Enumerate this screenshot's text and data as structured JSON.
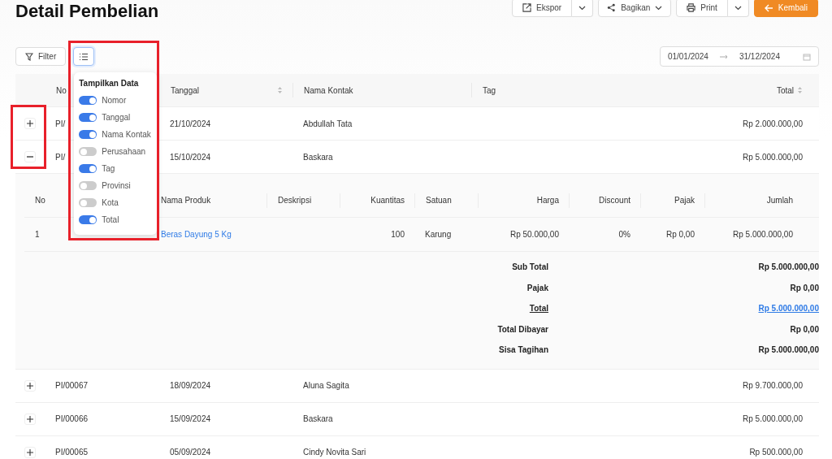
{
  "title": "Detail Pembelian",
  "actions": [
    {
      "label": "Ekspor",
      "kind": "split"
    },
    {
      "label": "Bagikan",
      "kind": "dropdown"
    },
    {
      "label": "Print",
      "kind": "split"
    },
    {
      "label": "Kembali",
      "kind": "primary"
    }
  ],
  "filter_button": {
    "label": "Filter"
  },
  "date_range": {
    "start": "01/01/2024",
    "end": "31/12/2024"
  },
  "column_menu": {
    "title": "Tampilkan Data",
    "items": [
      {
        "label": "Nomor",
        "on": true
      },
      {
        "label": "Tanggal",
        "on": true
      },
      {
        "label": "Nama Kontak",
        "on": true
      },
      {
        "label": "Perusahaan",
        "on": false
      },
      {
        "label": "Tag",
        "on": true
      },
      {
        "label": "Provinsi",
        "on": false
      },
      {
        "label": "Kota",
        "on": false
      },
      {
        "label": "Total",
        "on": true
      }
    ]
  },
  "table": {
    "columns": [
      {
        "label": "No"
      },
      {
        "label": "Tanggal",
        "sortable": true
      },
      {
        "label": "Nama Kontak",
        "sortable": false
      },
      {
        "label": "Tag",
        "sortable": false
      },
      {
        "label": "Total",
        "sortable": true
      }
    ],
    "rows": [
      {
        "expanded": false,
        "nomor": "PI/",
        "tanggal": "21/10/2024",
        "kontak": "Abdullah Tata",
        "total": "Rp 2.000.000,00"
      },
      {
        "expanded": true,
        "nomor": "PI/",
        "tanggal": "15/10/2024",
        "kontak": "Baskara",
        "total": "Rp 5.000.000,00",
        "detail": {
          "columns": [
            "No",
            "Nama Produk",
            "Deskripsi",
            "Kuantitas",
            "Satuan",
            "Harga",
            "Discount",
            "Pajak",
            "Jumlah"
          ],
          "items": [
            {
              "no": "1",
              "produk": "Beras Dayung 5 Kg",
              "kuantitas": "100",
              "satuan": "Karung",
              "harga": "Rp 50.000,00",
              "discount": "0%",
              "pajak": "Rp 0,00",
              "jumlah": "Rp 5.000.000,00"
            }
          ],
          "summary": [
            {
              "label": "Sub Total",
              "value": "Rp 5.000.000,00",
              "kind": "plain"
            },
            {
              "label": "Pajak",
              "value": "Rp 0,00",
              "kind": "plain"
            },
            {
              "label": "Total",
              "value": "Rp 5.000.000,00",
              "kind": "link"
            },
            {
              "label": "Total Dibayar",
              "value": "Rp 0,00",
              "kind": "plain"
            },
            {
              "label": "Sisa Tagihan",
              "value": "Rp 5.000.000,00",
              "kind": "plain"
            }
          ]
        }
      },
      {
        "expanded": false,
        "nomor": "PI/00067",
        "tanggal": "18/09/2024",
        "kontak": "Aluna Sagita",
        "total": "Rp 9.700.000,00"
      },
      {
        "expanded": false,
        "nomor": "PI/00066",
        "tanggal": "15/09/2024",
        "kontak": "Baskara",
        "total": "Rp 5.000.000,00"
      },
      {
        "expanded": false,
        "nomor": "PI/00065",
        "tanggal": "05/09/2024",
        "kontak": "Cindy Novita Sari",
        "total": "Rp 500.000,00"
      }
    ]
  }
}
